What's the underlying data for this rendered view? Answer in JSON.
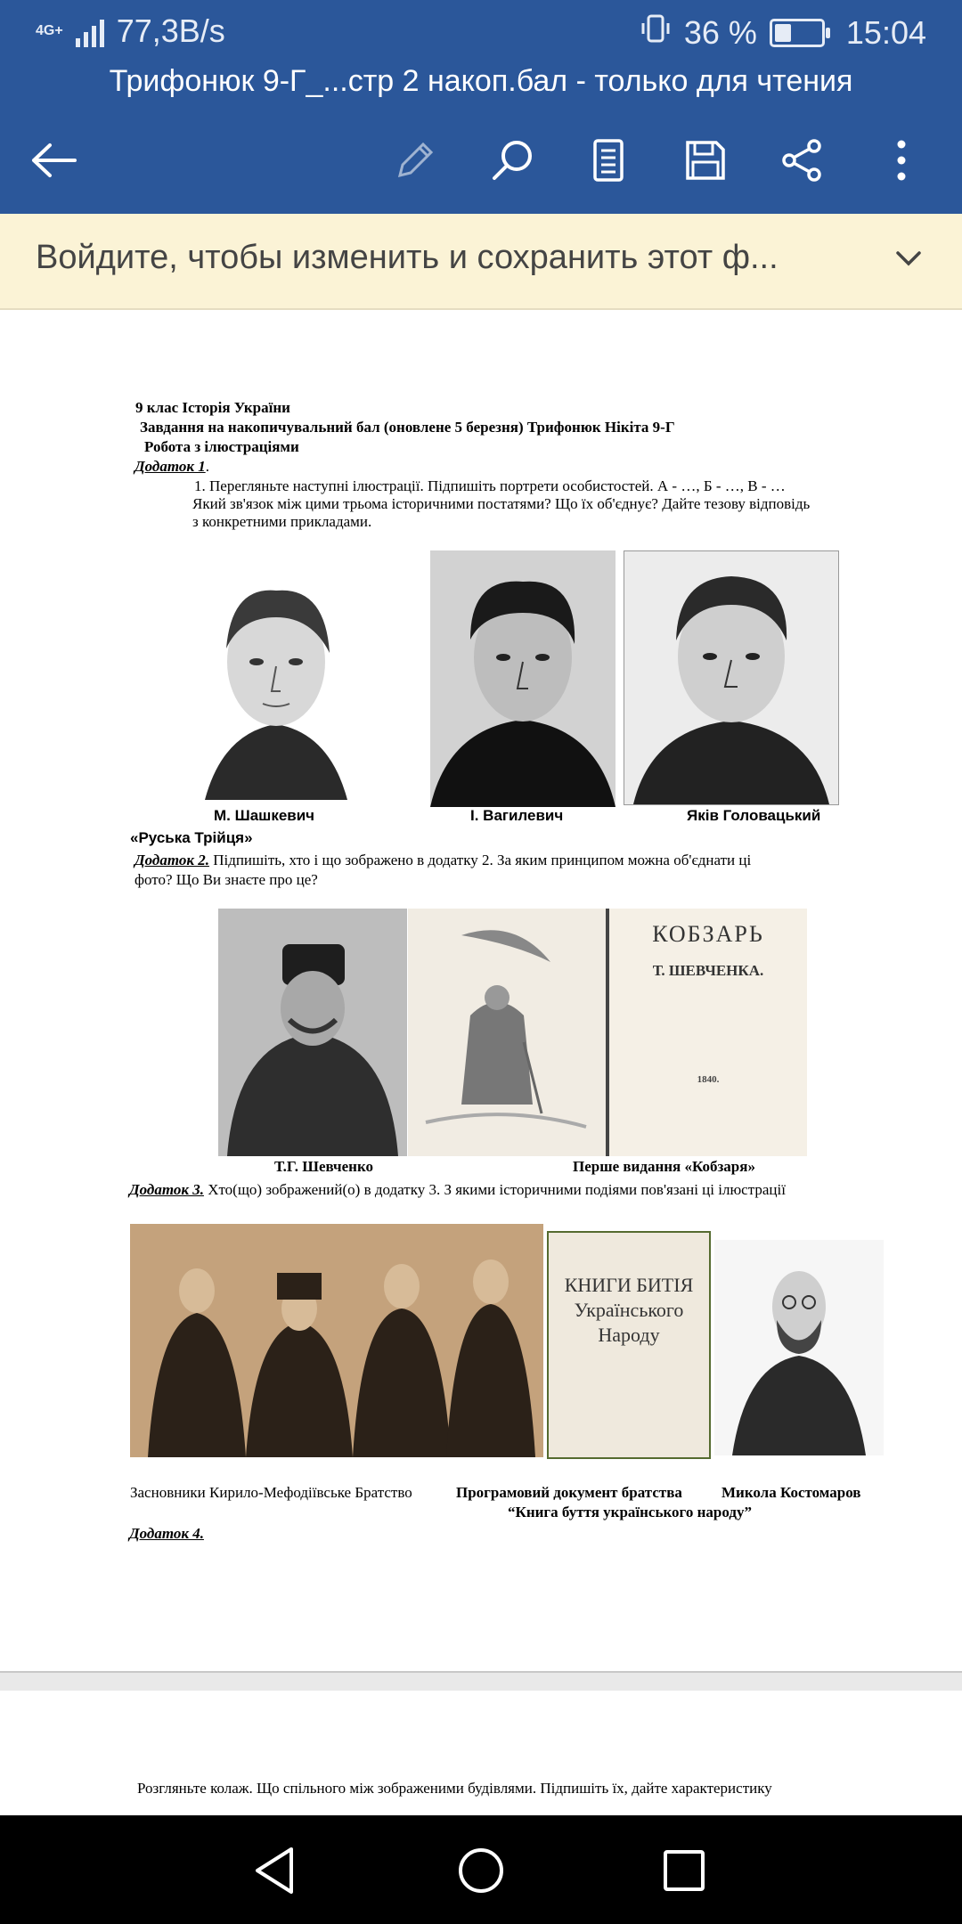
{
  "status_bar": {
    "network_label": "4G+",
    "net_speed": "77,3B/s",
    "battery_pct": "36 %",
    "battery_level": 0.36,
    "time": "15:04"
  },
  "app": {
    "title": "Трифонюк 9-Г_...стр 2 накоп.бал - только для чтения",
    "toolbar_icons": [
      "back-arrow-icon",
      "pencil-icon",
      "search-icon",
      "reading-view-icon",
      "save-icon",
      "share-icon",
      "more-icon"
    ]
  },
  "banner": {
    "text": "Войдите, чтобы изменить и сохранить этот ф..."
  },
  "doc": {
    "line1": "9 клас  Історія України",
    "line2": "Завдання на накопичувальний бал (оновлене 5 березня) Трифонюк Нікіта 9-Г",
    "line3": "Робота з ілюстраціями",
    "add1_label": "Додаток 1",
    "add1_dot": ".",
    "add1_text1": "1.    Перегляньте наступні ілюстрації. Підпишіть портрети особистостей. А - …, Б - …, В - …",
    "add1_text2": "Який зв'язок між цими трьома історичними постатями? Що їх об'єднує? Дайте тезову відповідь",
    "add1_text3": "з конкретними прикладами.",
    "cap1": "М. Шашкевич",
    "cap2": "І. Вагилевич",
    "cap3": "Яків Головацький",
    "group_label": "«Руська Трійця»",
    "add2_label": "Додаток 2.",
    "add2_text1": " Підпишіть, хто і що зображено в додатку 2. За яким принципом можна об'єднати ці",
    "add2_text2": "фото? Що Ви знаєте про це?",
    "book1_title": "КОБЗАРЬ",
    "book1_author": "Т. ШЕВЧЕНКА.",
    "book1_year": "1840.",
    "cap4": "Т.Г. Шевченко",
    "cap5": "Перше видання «Кобзаря»",
    "add3_label": "Додаток 3.",
    "add3_text": " Хто(що) зображений(о) в додатку 3.  З якими історичними подіями пов'язані ці ілюстрації",
    "book2_title": "КНИГИ БИТІЯ Українського Народу",
    "cap6": "Засновники  Кирило-Мефодіївське Братство",
    "cap7": "Програмовий документ братства",
    "cap8": "Микола Костомаров",
    "cap9": "“Книга буття українського народу”",
    "add4_label": "Додаток 4.",
    "page2_text": "Розгляньте колаж. Що спільного між зображеними будівлями. Підпишіть їх, дайте характеристику"
  },
  "nav_bar": {
    "icons": [
      "back-triangle-icon",
      "home-circle-icon",
      "recents-square-icon"
    ]
  }
}
